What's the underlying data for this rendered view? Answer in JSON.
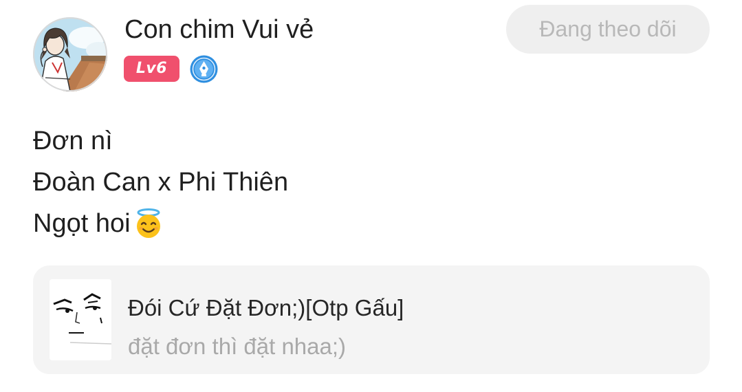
{
  "user": {
    "name": "Con chim Vui vẻ",
    "level_badge": "Lv6",
    "avatar_icon": "anime-girl-avatar",
    "verified_icon": "pen-nib-badge-icon"
  },
  "follow_button": {
    "label": "Đang theo dõi"
  },
  "post": {
    "lines": [
      "Đơn nì",
      "Đoàn Can x Phi Thiên",
      "Ngọt hoi"
    ],
    "emoji": "smiling-face-with-halo"
  },
  "linked_story": {
    "title": "Đói Cứ Đặt Đơn;)[Otp Gấu]",
    "subtitle": "đặt đơn thì đặt nhaa;)",
    "thumbnail_icon": "meme-face-sketch"
  },
  "colors": {
    "level_badge_bg": "#f0506d",
    "verified_blue": "#2f8fe0",
    "follow_button_bg": "#efefef",
    "follow_button_text": "#b8b8b8",
    "card_bg": "#f4f4f4",
    "subtitle_text": "#a9a9a9"
  }
}
